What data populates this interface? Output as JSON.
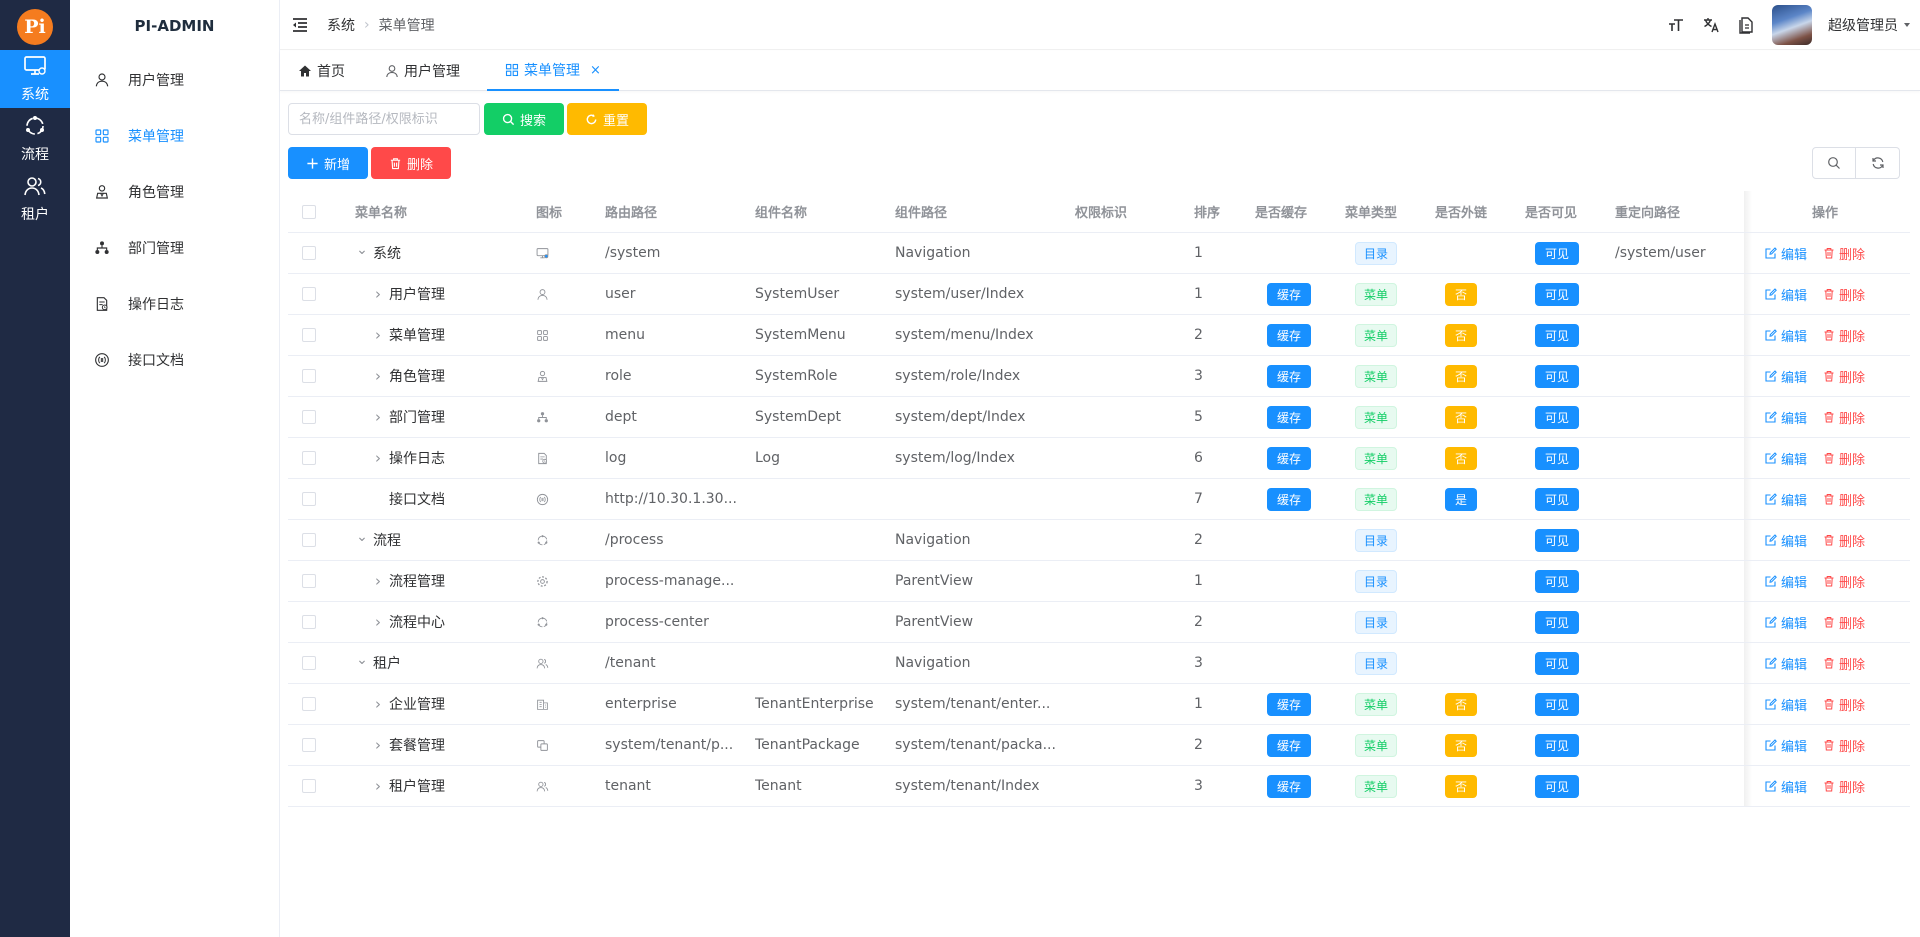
{
  "app": {
    "logo_text": "Pi",
    "title": "PI-ADMIN"
  },
  "rail": [
    {
      "label": "系统",
      "icon": "monitor-icon",
      "active": true
    },
    {
      "label": "流程",
      "icon": "process-icon",
      "active": false
    },
    {
      "label": "租户",
      "icon": "users-icon",
      "active": false
    }
  ],
  "submenu": [
    {
      "label": "用户管理",
      "icon": "user-icon",
      "active": false
    },
    {
      "label": "菜单管理",
      "icon": "grid-icon",
      "active": true
    },
    {
      "label": "角色管理",
      "icon": "role-icon",
      "active": false
    },
    {
      "label": "部门管理",
      "icon": "tree-icon",
      "active": false
    },
    {
      "label": "操作日志",
      "icon": "log-icon",
      "active": false
    },
    {
      "label": "接口文档",
      "icon": "api-icon",
      "active": false
    }
  ],
  "header": {
    "breadcrumb": [
      "系统",
      "菜单管理"
    ],
    "user_name": "超级管理员"
  },
  "tabs": [
    {
      "label": "首页",
      "icon": "home-icon",
      "active": false,
      "closable": false
    },
    {
      "label": "用户管理",
      "icon": "user-icon",
      "active": false,
      "closable": false
    },
    {
      "label": "菜单管理",
      "icon": "grid-icon",
      "active": true,
      "closable": true,
      "close_glyph": "×"
    }
  ],
  "search": {
    "placeholder": "名称/组件路径/权限标识",
    "value": "",
    "search_label": "搜索",
    "reset_label": "重置"
  },
  "toolbar": {
    "add_label": "新增",
    "delete_label": "删除"
  },
  "colors": {
    "primary": "#1890ff",
    "success": "#13ce66",
    "warning": "#ffba00",
    "danger": "#ff4949",
    "rail_bg": "#1f2a44"
  },
  "table": {
    "headers": [
      "菜单名称",
      "图标",
      "路由路径",
      "组件名称",
      "组件路径",
      "权限标识",
      "排序",
      "是否缓存",
      "菜单类型",
      "是否外链",
      "是否可见",
      "重定向路径",
      "操作"
    ],
    "actions": {
      "edit": "编辑",
      "delete": "删除"
    },
    "rows": [
      {
        "level": 0,
        "expand": "open",
        "name": "系统",
        "icon": "monitor-icon",
        "path": "/system",
        "component_name": "",
        "component_path": "Navigation",
        "perm": "",
        "sort": "1",
        "cache": "",
        "type": "目录",
        "type_kind": "dir",
        "external": "",
        "visible": "可见",
        "redirect": "/system/user"
      },
      {
        "level": 1,
        "expand": "closed",
        "name": "用户管理",
        "icon": "user-icon",
        "path": "user",
        "component_name": "SystemUser",
        "component_path": "system/user/Index",
        "perm": "",
        "sort": "1",
        "cache": "缓存",
        "type": "菜单",
        "type_kind": "menu",
        "external": "否",
        "visible": "可见",
        "redirect": ""
      },
      {
        "level": 1,
        "expand": "closed",
        "name": "菜单管理",
        "icon": "grid-icon",
        "path": "menu",
        "component_name": "SystemMenu",
        "component_path": "system/menu/Index",
        "perm": "",
        "sort": "2",
        "cache": "缓存",
        "type": "菜单",
        "type_kind": "menu",
        "external": "否",
        "visible": "可见",
        "redirect": ""
      },
      {
        "level": 1,
        "expand": "closed",
        "name": "角色管理",
        "icon": "role-icon",
        "path": "role",
        "component_name": "SystemRole",
        "component_path": "system/role/Index",
        "perm": "",
        "sort": "3",
        "cache": "缓存",
        "type": "菜单",
        "type_kind": "menu",
        "external": "否",
        "visible": "可见",
        "redirect": ""
      },
      {
        "level": 1,
        "expand": "closed",
        "name": "部门管理",
        "icon": "tree-icon",
        "path": "dept",
        "component_name": "SystemDept",
        "component_path": "system/dept/Index",
        "perm": "",
        "sort": "5",
        "cache": "缓存",
        "type": "菜单",
        "type_kind": "menu",
        "external": "否",
        "visible": "可见",
        "redirect": ""
      },
      {
        "level": 1,
        "expand": "closed",
        "name": "操作日志",
        "icon": "log-icon",
        "path": "log",
        "component_name": "Log",
        "component_path": "system/log/Index",
        "perm": "",
        "sort": "6",
        "cache": "缓存",
        "type": "菜单",
        "type_kind": "menu",
        "external": "否",
        "visible": "可见",
        "redirect": ""
      },
      {
        "level": 1,
        "expand": "none",
        "name": "接口文档",
        "icon": "api-icon",
        "path": "http://10.30.1.30...",
        "component_name": "",
        "component_path": "",
        "perm": "",
        "sort": "7",
        "cache": "缓存",
        "type": "菜单",
        "type_kind": "menu",
        "external": "是",
        "visible": "可见",
        "redirect": ""
      },
      {
        "level": 0,
        "expand": "open",
        "name": "流程",
        "icon": "process-icon",
        "path": "/process",
        "component_name": "",
        "component_path": "Navigation",
        "perm": "",
        "sort": "2",
        "cache": "",
        "type": "目录",
        "type_kind": "dir",
        "external": "",
        "visible": "可见",
        "redirect": ""
      },
      {
        "level": 1,
        "expand": "closed",
        "name": "流程管理",
        "icon": "gear-icon",
        "path": "process-manage...",
        "component_name": "",
        "component_path": "ParentView",
        "perm": "",
        "sort": "1",
        "cache": "",
        "type": "目录",
        "type_kind": "dir",
        "external": "",
        "visible": "可见",
        "redirect": ""
      },
      {
        "level": 1,
        "expand": "closed",
        "name": "流程中心",
        "icon": "process-icon",
        "path": "process-center",
        "component_name": "",
        "component_path": "ParentView",
        "perm": "",
        "sort": "2",
        "cache": "",
        "type": "目录",
        "type_kind": "dir",
        "external": "",
        "visible": "可见",
        "redirect": ""
      },
      {
        "level": 0,
        "expand": "open",
        "name": "租户",
        "icon": "users-icon",
        "path": "/tenant",
        "component_name": "",
        "component_path": "Navigation",
        "perm": "",
        "sort": "3",
        "cache": "",
        "type": "目录",
        "type_kind": "dir",
        "external": "",
        "visible": "可见",
        "redirect": ""
      },
      {
        "level": 1,
        "expand": "closed",
        "name": "企业管理",
        "icon": "building-icon",
        "path": "enterprise",
        "component_name": "TenantEnterprise",
        "component_path": "system/tenant/enter...",
        "perm": "",
        "sort": "1",
        "cache": "缓存",
        "type": "菜单",
        "type_kind": "menu",
        "external": "否",
        "visible": "可见",
        "redirect": ""
      },
      {
        "level": 1,
        "expand": "closed",
        "name": "套餐管理",
        "icon": "package-icon",
        "path": "system/tenant/p...",
        "component_name": "TenantPackage",
        "component_path": "system/tenant/packa...",
        "perm": "",
        "sort": "2",
        "cache": "缓存",
        "type": "菜单",
        "type_kind": "menu",
        "external": "否",
        "visible": "可见",
        "redirect": ""
      },
      {
        "level": 1,
        "expand": "closed",
        "name": "租户管理",
        "icon": "users-icon",
        "path": "tenant",
        "component_name": "Tenant",
        "component_path": "system/tenant/Index",
        "perm": "",
        "sort": "3",
        "cache": "缓存",
        "type": "菜单",
        "type_kind": "menu",
        "external": "否",
        "visible": "可见",
        "redirect": ""
      }
    ]
  }
}
